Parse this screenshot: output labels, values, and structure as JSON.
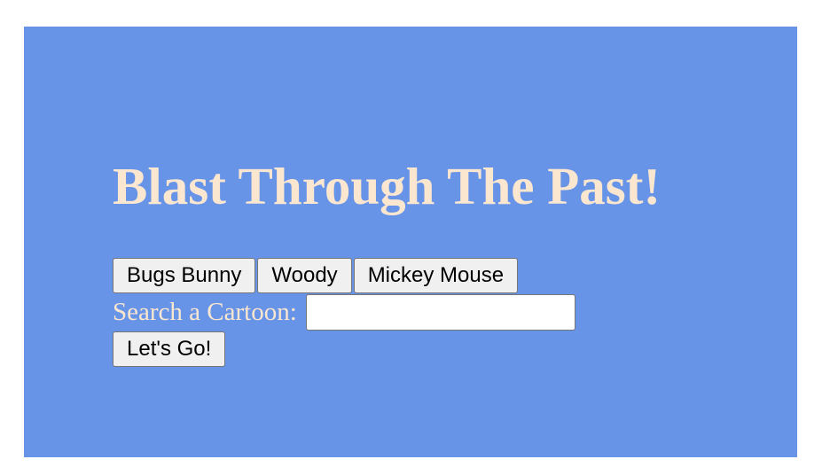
{
  "header": {
    "title": "Blast Through The Past!"
  },
  "cartoon_buttons": [
    {
      "label": "Bugs Bunny"
    },
    {
      "label": "Woody"
    },
    {
      "label": "Mickey Mouse"
    }
  ],
  "search": {
    "label": "Search a Cartoon:",
    "value": "",
    "placeholder": ""
  },
  "submit": {
    "label": "Let's Go!"
  },
  "colors": {
    "panel_background": "#6894e8",
    "text_accent": "#fbe6cf",
    "page_background": "#ffffff"
  }
}
